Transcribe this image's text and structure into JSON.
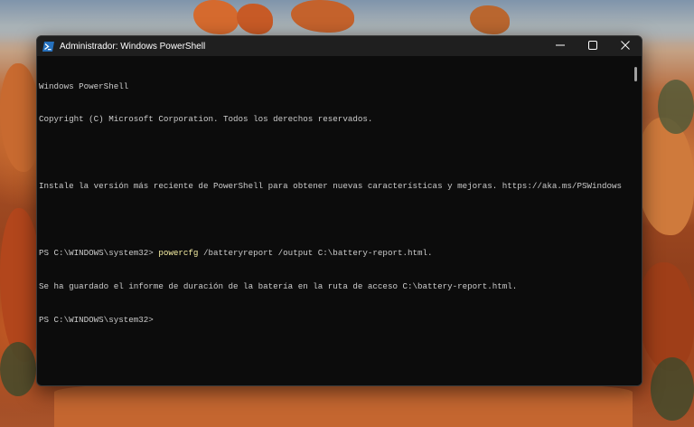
{
  "window": {
    "title": "Administrador: Windows PowerShell",
    "icon": "powershell-icon",
    "controls": {
      "minimize_icon": "minimize-icon",
      "maximize_icon": "maximize-icon",
      "close_icon": "close-icon"
    }
  },
  "console": {
    "lines": [
      {
        "prompt": "",
        "command": "",
        "output": "Windows PowerShell"
      },
      {
        "prompt": "",
        "command": "",
        "output": "Copyright (C) Microsoft Corporation. Todos los derechos reservados."
      },
      {
        "prompt": "",
        "command": "",
        "output": ""
      },
      {
        "prompt": "",
        "command": "",
        "output": "Instale la versión más reciente de PowerShell para obtener nuevas características y mejoras. https://aka.ms/PSWindows"
      },
      {
        "prompt": "",
        "command": "",
        "output": ""
      },
      {
        "prompt": "PS C:\\WINDOWS\\system32> ",
        "command": "powercfg",
        "output": " /batteryreport /output C:\\battery-report.html."
      },
      {
        "prompt": "",
        "command": "",
        "output": "Se ha guardado el informe de duración de la batería en la ruta de acceso C:\\battery-report.html."
      },
      {
        "prompt": "PS C:\\WINDOWS\\system32>",
        "command": "",
        "output": ""
      }
    ]
  },
  "colors": {
    "console_background": "#0c0c0c",
    "console_text": "#cccccc",
    "command_highlight": "#f9f1a5",
    "titlebar": "#1f1f1f"
  }
}
